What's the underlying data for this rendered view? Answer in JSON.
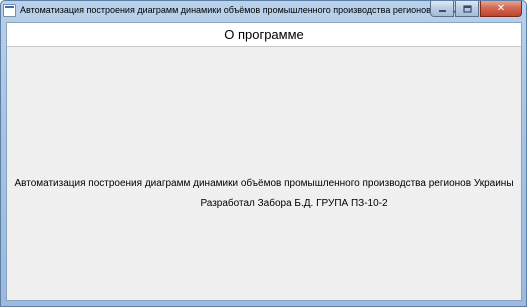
{
  "window": {
    "title": "Автоматизация построения диаграмм динамики объёмов промышленного производства регионов Украины",
    "icon": "app-icon"
  },
  "caption_buttons": {
    "minimize": "minimize-icon",
    "maximize": "maximize-icon",
    "close_label": "✕"
  },
  "header": {
    "title": "О программе"
  },
  "content": {
    "description": "Автоматизация построения диаграмм динамики объёмов промышленного производства регионов Украины",
    "author": "Разработал Забора Б.Д. ГРУПА ПЗ-10-2"
  },
  "colors": {
    "titlebar": "#b9d1ea",
    "close_button": "#c0452b",
    "client_bg": "#f0f0f0"
  }
}
